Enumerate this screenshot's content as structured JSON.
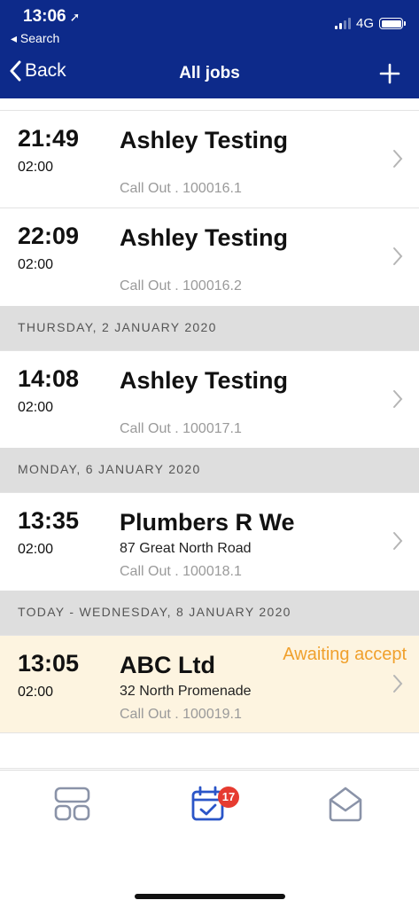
{
  "status_bar": {
    "time": "13:06",
    "location_glyph": "➚",
    "back_app": "◂ Search",
    "network": "4G"
  },
  "nav": {
    "back_label": "Back",
    "title": "All jobs",
    "add_icon": "plus-icon"
  },
  "sections": [
    {
      "label": "THURSDAY, 2 JANUARY 2020"
    },
    {
      "label": "MONDAY, 6 JANUARY 2020"
    },
    {
      "label": "TODAY - WEDNESDAY, 8 JANUARY 2020"
    }
  ],
  "jobs": [
    {
      "time": "21:49",
      "duration": "02:00",
      "name": "Ashley Testing",
      "address": "",
      "ref": "Call Out . 100016.1",
      "status": ""
    },
    {
      "time": "22:09",
      "duration": "02:00",
      "name": "Ashley Testing",
      "address": "",
      "ref": "Call Out . 100016.2",
      "status": ""
    },
    {
      "time": "14:08",
      "duration": "02:00",
      "name": "Ashley Testing",
      "address": "",
      "ref": "Call Out . 100017.1",
      "status": ""
    },
    {
      "time": "13:35",
      "duration": "02:00",
      "name": "Plumbers R We",
      "address": "87 Great North Road",
      "ref": "Call Out . 100018.1",
      "status": ""
    },
    {
      "time": "13:05",
      "duration": "02:00",
      "name": "ABC Ltd",
      "address": "32 North Promenade",
      "ref": "Call Out . 100019.1",
      "status": "Awaiting accept"
    }
  ],
  "tabbar": {
    "tabs": [
      {
        "icon": "dashboard-icon"
      },
      {
        "icon": "calendar-check-icon",
        "badge": "17"
      },
      {
        "icon": "mail-icon"
      }
    ]
  },
  "colors": {
    "header_bg": "#0d2a8a",
    "accent": "#2a55c8",
    "status_pending": "#f0a02c",
    "highlight_row": "#fdf4e0",
    "badge": "#e63b30"
  }
}
